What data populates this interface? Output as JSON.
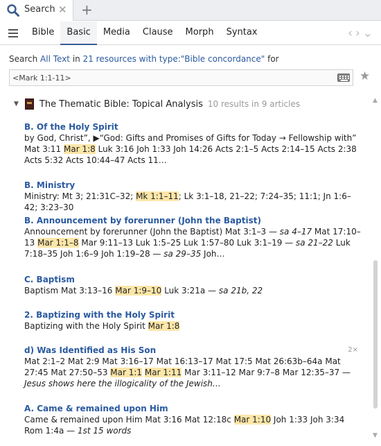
{
  "tab": {
    "title": "Search",
    "close_glyph": "✕",
    "add_glyph": "+"
  },
  "toolbar": {
    "modes": [
      "Bible",
      "Basic",
      "Media",
      "Clause",
      "Morph",
      "Syntax"
    ],
    "active_mode": "Basic",
    "back_glyph": "‹",
    "forward_glyph": "›",
    "menu_glyph": "⌄"
  },
  "query": {
    "prefix": "Search ",
    "scope": "All Text",
    "middle": " in ",
    "resources": "21 resources with type:\"Bible concordance\"",
    "suffix": " for",
    "value": "<Mark 1:1-11>"
  },
  "results": {
    "group_title": "The Thematic Bible: Topical Analysis",
    "group_count": "10 results in 9 articles",
    "entries": [
      {
        "title": "B. Of the Holy Spirit",
        "parts": [
          "by God, Christ”, ▶“God: Gifts and Promises of Gifts for Today → Fellowship with” Mat 3:11 ",
          "Mar 1:8",
          " Luk 3:16 Joh 1:33 Joh 14:26 Acts 2:1–5 Acts 2:14–15 Acts 2:38 Acts 5:32 Acts 10:44–47 Acts 11…"
        ]
      },
      {
        "title": "B. Ministry",
        "parts": [
          "Ministry: Mt 3; 21:31C–32; ",
          "Mk 1:1–11",
          "; Lk 3:1–18, 21–22; 7:24–35; 11:1; Jn 1:6–42; 3:23–30"
        ]
      },
      {
        "title": "B. Announcement by forerunner (John the Baptist)",
        "parts": [
          "Announcement by forerunner (John the Baptist) Mat 3:1–3 — ",
          "sa 4–17",
          " Mat 17:10–13 ",
          "Mar 1:1–8",
          " Mar 9:11–13 Luk 1:5–25 Luk 1:57–80 Luk 3:1–19 — ",
          "sa 21–22",
          " Luk 7:18–35 Joh 1:6–9 Joh 1:19–28 — ",
          "sa 29–35",
          " Joh…"
        ]
      },
      {
        "title": "C. Baptism",
        "parts": [
          "Baptism Mat 3:13–16 ",
          "Mar 1:9–10",
          " Luk 3:21a — ",
          "sa 21b, 22",
          ""
        ]
      },
      {
        "title": "2. Baptizing with the Holy Spirit",
        "parts": [
          "Baptizing with the Holy Spirit ",
          "Mar 1:8",
          ""
        ]
      },
      {
        "title": "d) Was Identified as His Son",
        "badge": "2×",
        "parts": [
          "Mat 2:1–2 Mat 2:9 Mat 3:16–17 Mat 16:13–17 Mat 17:5 Mat 26:63b–64a Mat 27:45 Mat 27:50–53 ",
          "Mar 1:1",
          " ",
          "Mar 1:11",
          " Mar 3:11–12 Mar 9:7–8 Mar 12:35–37 — ",
          "Jesus shows here the illogicality of the Jewish…",
          ""
        ]
      },
      {
        "title": "A. Came & remained upon Him",
        "parts": [
          "Came & remained upon Him Mat 3:16 Mat 12:18c ",
          "Mar 1:10",
          " Joh 1:33 Joh 3:34 Rom 1:4a — ",
          "1st 15 words",
          ""
        ]
      }
    ]
  },
  "scrollbar": {
    "up_glyph": "▲",
    "down_glyph": "▼"
  },
  "colors": {
    "link": "#2a5aa0",
    "highlight": "#fde6a8",
    "active_tab_underline": "#3a5e9a"
  }
}
